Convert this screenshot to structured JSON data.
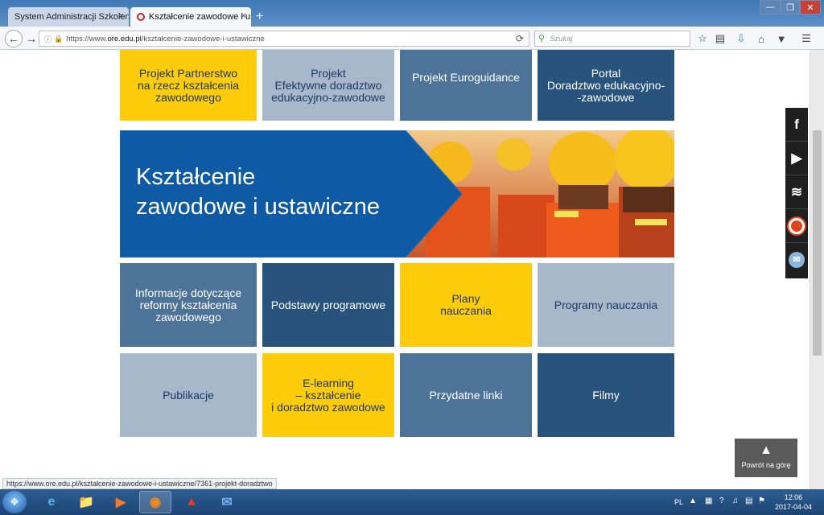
{
  "browser": {
    "tabs": [
      {
        "label": "System Administracji Szkolenia...",
        "close": "×"
      },
      {
        "label": "Kształcenie zawodowe i ustа...",
        "close": "×"
      }
    ],
    "new_tab": "+",
    "window_buttons": {
      "minimize": "—",
      "maximize": "❐",
      "close": "✕"
    },
    "url_prefix": "https://www.",
    "url_host": "ore.edu.pl",
    "url_path": "/kształcenie-zawodowe-i-ustawiczne",
    "search_placeholder": "Szukaj"
  },
  "page": {
    "top_tiles": [
      {
        "label": "Projekt Partnerstwo\nna rzecz kształcenia\nzawodowego",
        "color": "yellow"
      },
      {
        "label": "Projekt\nEfektywne doradztwo\nedukacyjno-zawodowe",
        "color": "light"
      },
      {
        "label": "Projekt Euroguidance",
        "color": "mid"
      },
      {
        "label": "Portal\nDoradztwo edukacyjno-\n-zawodowe",
        "color": "dark"
      }
    ],
    "banner_title": "Kształcenie\nzawodowe i ustawiczne",
    "row1_tiles": [
      {
        "label": "Informacje dotyczące\nreformy kształcenia\nzawodowego",
        "color": "mid"
      },
      {
        "label": "Podstawy programowe",
        "color": "dark"
      },
      {
        "label": "Plany\nnauczania",
        "color": "yellow"
      },
      {
        "label": "Programy nauczania",
        "color": "light"
      }
    ],
    "row2_tiles": [
      {
        "label": "Publikacje",
        "color": "light"
      },
      {
        "label": "E-learning\n– kształcenie\ni doradztwo zawodowe",
        "color": "yellow"
      },
      {
        "label": "Przydatne linki",
        "color": "mid"
      },
      {
        "label": "Filmy",
        "color": "dark"
      }
    ],
    "back_to_top": "Powrót na górę",
    "status_url": "https://www.ore.edu.pl/kształcenie-zawodowe-i-ustawiczne/7361-projekt-doradztwo"
  },
  "colors": {
    "yellow": "#fecc0a",
    "light": "#a7b8cb",
    "mid": "#4d7498",
    "dark": "#28537c",
    "banner_blue": "#0f5aa5"
  },
  "social_icons": [
    "facebook-icon",
    "youtube-icon",
    "rss-icon",
    "target-icon",
    "mail-icon"
  ],
  "taskbar": {
    "language": "PL",
    "time": "12:06",
    "date": "2017-04-04"
  }
}
